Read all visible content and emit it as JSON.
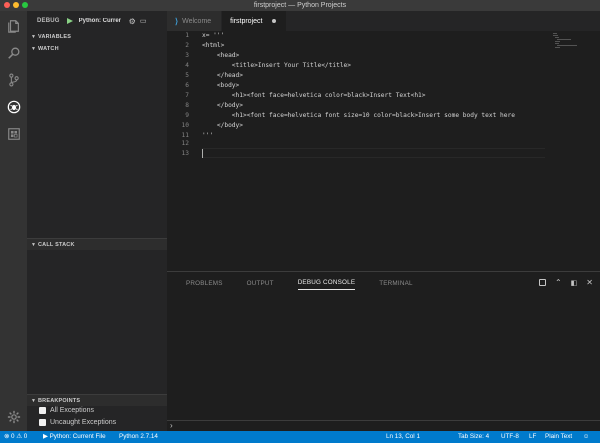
{
  "window": {
    "title": "firstproject — Python Projects"
  },
  "traffic_lights": [
    "#fe5f57",
    "#febc2e",
    "#28c840"
  ],
  "activity_bar": {
    "icons": [
      "files-icon",
      "search-icon",
      "source-control-icon",
      "debug-icon",
      "extensions-icon"
    ],
    "bottom_icon": "gear-icon"
  },
  "sidebar": {
    "debug_label": "DEBUG",
    "config_select": "Python: Currer",
    "sections": {
      "variables": "VARIABLES",
      "watch": "WATCH",
      "call_stack": "CALL STACK",
      "breakpoints": "BREAKPOINTS"
    },
    "breakpoints": [
      {
        "label": "All Exceptions",
        "checked": false
      },
      {
        "label": "Uncaught Exceptions",
        "checked": false
      }
    ]
  },
  "tabs": [
    {
      "label": "Welcome",
      "active": false
    },
    {
      "label": "firstproject",
      "active": true,
      "dirty": true
    }
  ],
  "editor": {
    "lines": [
      {
        "n": "1",
        "text": "x= '''"
      },
      {
        "n": "2",
        "text": "<html>"
      },
      {
        "n": "3",
        "text": "    <head>"
      },
      {
        "n": "4",
        "text": "        <title>Insert Your Title</title>"
      },
      {
        "n": "5",
        "text": "    </head>"
      },
      {
        "n": "6",
        "text": "    <body>"
      },
      {
        "n": "7",
        "text": "        <h1><font face=helvetica color=black>Insert Text<h1>"
      },
      {
        "n": "8",
        "text": "    </body>"
      },
      {
        "n": "9",
        "text": "        <h1><font face=helvetica font size=10 color=black>Insert some body text here"
      },
      {
        "n": "10",
        "text": "    </body>"
      },
      {
        "n": "11",
        "text": "'''"
      },
      {
        "n": "12",
        "text": ""
      },
      {
        "n": "13",
        "text": ""
      }
    ]
  },
  "panel": {
    "tabs": [
      {
        "label": "PROBLEMS",
        "active": false
      },
      {
        "label": "OUTPUT",
        "active": false
      },
      {
        "label": "DEBUG CONSOLE",
        "active": true
      },
      {
        "label": "TERMINAL",
        "active": false
      }
    ],
    "prompt": "›"
  },
  "statusbar": {
    "errors": "0",
    "warnings": "0",
    "run_config": "Python: Current File",
    "interpreter": "Python 2.7.14",
    "position": "Ln 13, Col 1",
    "tab_size": "Tab Size: 4",
    "encoding": "UTF-8",
    "eol": "LF",
    "language": "Plain Text",
    "background": "#007acc"
  }
}
